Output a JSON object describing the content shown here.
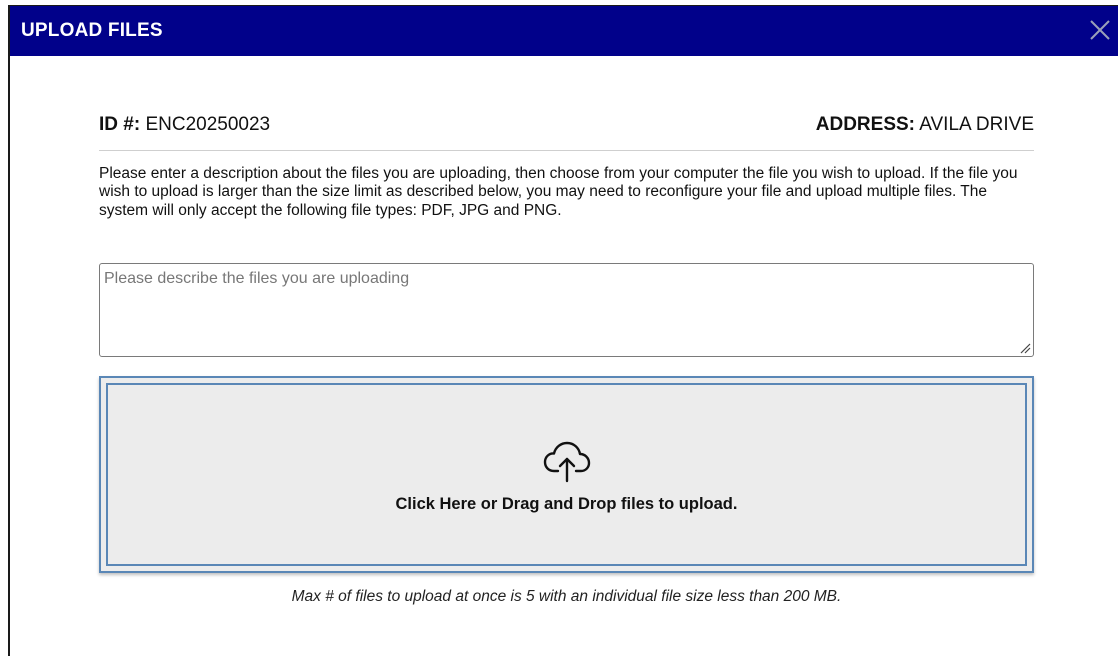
{
  "dialog": {
    "title": "UPLOAD FILES",
    "close_icon": "close-icon"
  },
  "record": {
    "id_label": "ID #:",
    "id_value": "ENC20250023",
    "address_label": "ADDRESS:",
    "address_value": "AVILA DRIVE"
  },
  "instructions": "Please enter a description about the files you are uploading, then choose from your computer the file you wish to upload. If the file you wish to upload is larger than the size limit as described below, you may need to reconfigure your file and upload multiple files. The system will only accept the following file types: PDF, JPG and PNG.",
  "description_field": {
    "placeholder": "Please describe the files you are uploading",
    "value": ""
  },
  "dropzone": {
    "icon": "cloud-upload-icon",
    "label": "Click Here or Drag and Drop files to upload."
  },
  "limit_note": "Max # of files to upload at once is 5 with an individual file size less than 200 MB.",
  "colors": {
    "titlebar": "#01018a",
    "dropzone_border": "#5a87b6",
    "dropzone_bg": "#ececec"
  }
}
